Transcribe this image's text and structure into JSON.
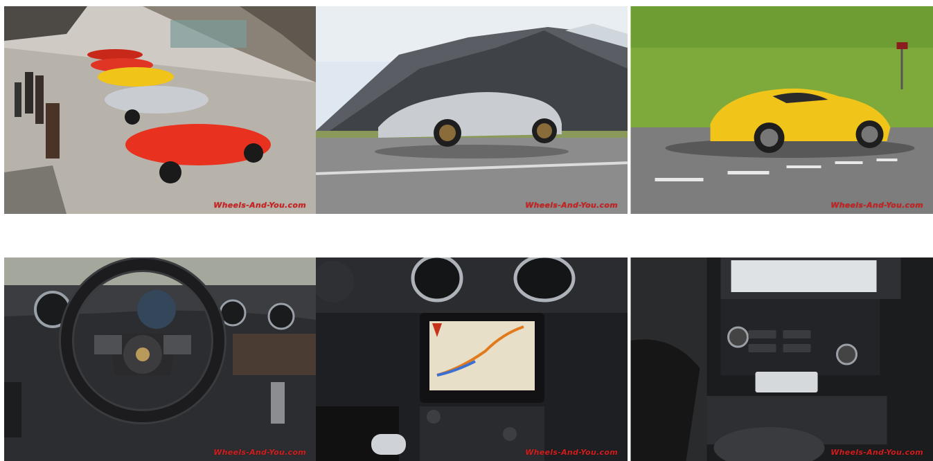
{
  "gallery": {
    "photos": [
      {
        "subject": "Porsche cars lined up at mountain pass parking",
        "watermark": "Wheels-And-You.com"
      },
      {
        "subject": "Silver Porsche Boxster on alpine road",
        "watermark": "Wheels-And-You.com"
      },
      {
        "subject": "Yellow Porsche Cayman on grass-lined road",
        "watermark": "Wheels-And-You.com"
      },
      {
        "subject": "Porsche interior with steering wheel",
        "watermark": "Wheels-And-You.com"
      },
      {
        "subject": "Center console navigation screen",
        "watermark": "Wheels-And-You.com"
      },
      {
        "subject": "Infotainment and climate control panel",
        "watermark": "Wheels-And-You.com"
      }
    ]
  },
  "colors": {
    "watermark": "#d11d1d",
    "red_car": "#e8321f",
    "yellow_car": "#f0c419",
    "silver_car": "#c9ccd1"
  }
}
